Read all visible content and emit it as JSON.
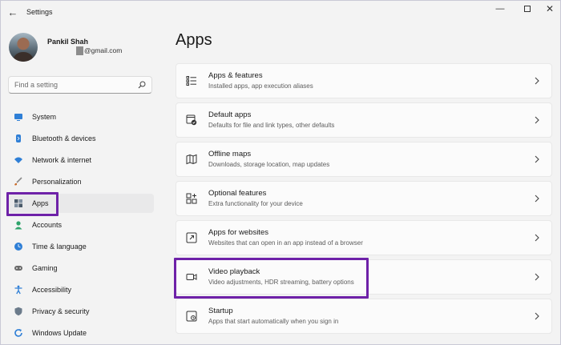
{
  "window": {
    "title": "Settings",
    "back_glyph": "←",
    "minimize_glyph": "—",
    "close_glyph": "✕"
  },
  "profile": {
    "name": "Pankil Shah",
    "email": "@gmail.com"
  },
  "search": {
    "placeholder": "Find a setting"
  },
  "sidebar": {
    "items": [
      {
        "label": "System",
        "icon": "system-icon",
        "color": "#2f7fd6"
      },
      {
        "label": "Bluetooth & devices",
        "icon": "bluetooth-icon",
        "color": "#2f7fd6"
      },
      {
        "label": "Network & internet",
        "icon": "wifi-icon",
        "color": "#2f7fd6"
      },
      {
        "label": "Personalization",
        "icon": "brush-icon",
        "color": "#c96b2a"
      },
      {
        "label": "Apps",
        "icon": "apps-icon",
        "color": "#4a5a6a",
        "selected": true
      },
      {
        "label": "Accounts",
        "icon": "person-icon",
        "color": "#2fa36b"
      },
      {
        "label": "Time & language",
        "icon": "globe-clock-icon",
        "color": "#2f7fd6"
      },
      {
        "label": "Gaming",
        "icon": "gamepad-icon",
        "color": "#6b6b6b"
      },
      {
        "label": "Accessibility",
        "icon": "accessibility-icon",
        "color": "#2f7fd6"
      },
      {
        "label": "Privacy & security",
        "icon": "shield-icon",
        "color": "#6b7b8b"
      },
      {
        "label": "Windows Update",
        "icon": "update-icon",
        "color": "#2f7fd6"
      }
    ]
  },
  "main": {
    "title": "Apps",
    "cards": [
      {
        "title": "Apps & features",
        "subtitle": "Installed apps, app execution aliases",
        "icon": "list-icon"
      },
      {
        "title": "Default apps",
        "subtitle": "Defaults for file and link types, other defaults",
        "icon": "default-apps-icon"
      },
      {
        "title": "Offline maps",
        "subtitle": "Downloads, storage location, map updates",
        "icon": "map-icon"
      },
      {
        "title": "Optional features",
        "subtitle": "Extra functionality for your device",
        "icon": "grid-plus-icon"
      },
      {
        "title": "Apps for websites",
        "subtitle": "Websites that can open in an app instead of a browser",
        "icon": "open-external-icon"
      },
      {
        "title": "Video playback",
        "subtitle": "Video adjustments, HDR streaming, battery options",
        "icon": "video-icon"
      },
      {
        "title": "Startup",
        "subtitle": "Apps that start automatically when you sign in",
        "icon": "startup-icon"
      }
    ]
  },
  "accent_colors": {
    "highlight": "#6e21a8"
  }
}
